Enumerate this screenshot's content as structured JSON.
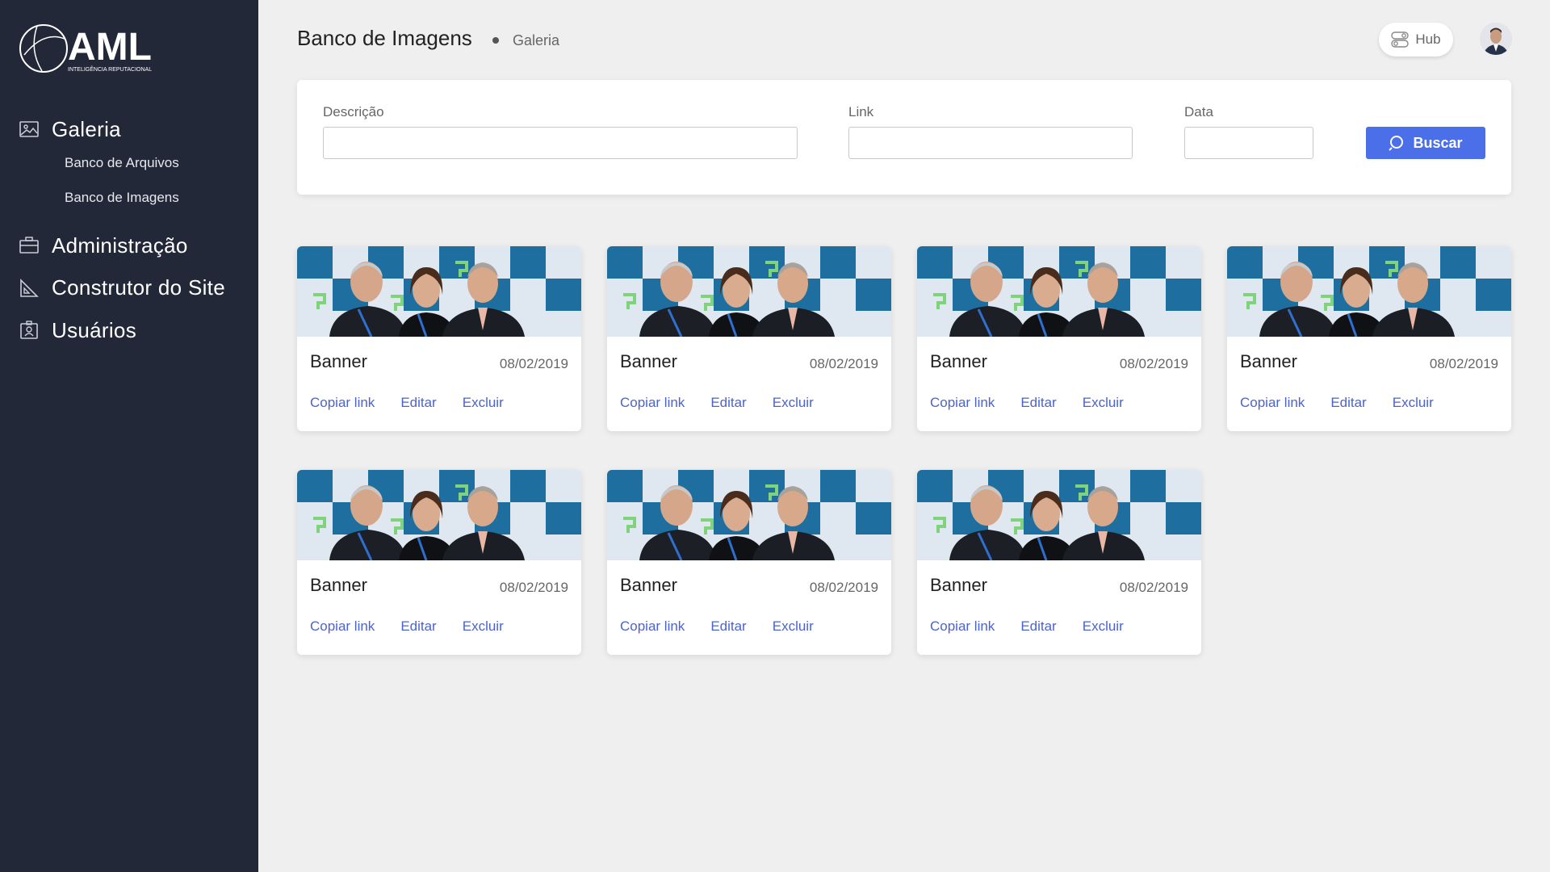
{
  "brand": {
    "logo_text": "AML",
    "logo_tagline": "INTELIGÊNCIA REPUTACIONAL"
  },
  "sidebar": {
    "items": [
      {
        "label": "Galeria",
        "icon": "image-icon",
        "children": [
          {
            "label": "Banco de Arquivos"
          },
          {
            "label": "Banco de Imagens"
          }
        ]
      },
      {
        "label": "Administração",
        "icon": "briefcase-icon"
      },
      {
        "label": "Construtor do Site",
        "icon": "ruler-triangle-icon"
      },
      {
        "label": "Usuários",
        "icon": "id-badge-icon"
      }
    ]
  },
  "header": {
    "title": "Banco de Imagens",
    "breadcrumb": "Galeria",
    "hub_label": "Hub"
  },
  "search": {
    "descricao_label": "Descrição",
    "descricao_value": "",
    "link_label": "Link",
    "link_value": "",
    "data_label": "Data",
    "data_value": "",
    "button_label": "Buscar"
  },
  "cards": [
    {
      "title": "Banner",
      "date": "08/02/2019",
      "actions": [
        "Copiar link",
        "Editar",
        "Excluir"
      ]
    },
    {
      "title": "Banner",
      "date": "08/02/2019",
      "actions": [
        "Copiar link",
        "Editar",
        "Excluir"
      ]
    },
    {
      "title": "Banner",
      "date": "08/02/2019",
      "actions": [
        "Copiar link",
        "Editar",
        "Excluir"
      ]
    },
    {
      "title": "Banner",
      "date": "08/02/2019",
      "actions": [
        "Copiar link",
        "Editar",
        "Excluir"
      ]
    },
    {
      "title": "Banner",
      "date": "08/02/2019",
      "actions": [
        "Copiar link",
        "Editar",
        "Excluir"
      ]
    },
    {
      "title": "Banner",
      "date": "08/02/2019",
      "actions": [
        "Copiar link",
        "Editar",
        "Excluir"
      ]
    },
    {
      "title": "Banner",
      "date": "08/02/2019",
      "actions": [
        "Copiar link",
        "Editar",
        "Excluir"
      ]
    }
  ],
  "colors": {
    "sidebar_bg": "#232838",
    "accent": "#4b6fe8",
    "link": "#4b63cf",
    "page_bg": "#efefef"
  }
}
